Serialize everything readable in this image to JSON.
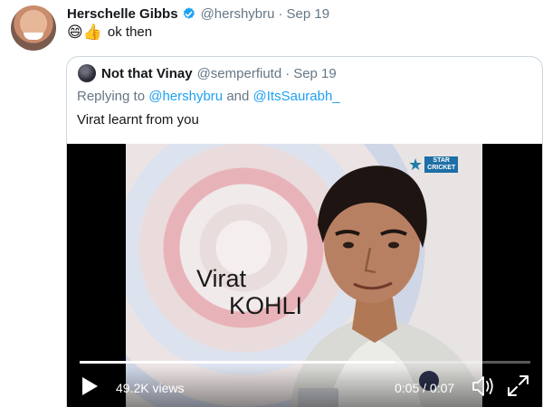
{
  "tweet": {
    "author_name": "Herschelle Gibbs",
    "handle": "@hershybru",
    "date": "Sep 19",
    "emojis": "😄👍",
    "text": "ok then"
  },
  "quoted": {
    "author_name": "Not that Vinay",
    "handle": "@semperfiutd",
    "date": "Sep 19",
    "reply_prefix": "Replying to",
    "reply_user1": "@hershybru",
    "reply_and": "and",
    "reply_user2": "@ItsSaurabh_",
    "text": "Virat learnt from you"
  },
  "video": {
    "logo_text_line1": "STAR",
    "logo_text_line2": "CRICKET",
    "caption_first": "Virat",
    "caption_last": "KOHLI",
    "views": "49.2K views",
    "time": "0:05 / 0:07",
    "progress": 0.7
  },
  "separator": "·",
  "colors": {
    "link": "#1da1f2",
    "secondary_text": "#657786",
    "border": "#ccd6dd",
    "verified": "#1da1f2"
  },
  "icons": {
    "verified": "verified-badge-icon",
    "play": "play-icon",
    "volume": "volume-icon",
    "fullscreen": "fullscreen-icon"
  }
}
